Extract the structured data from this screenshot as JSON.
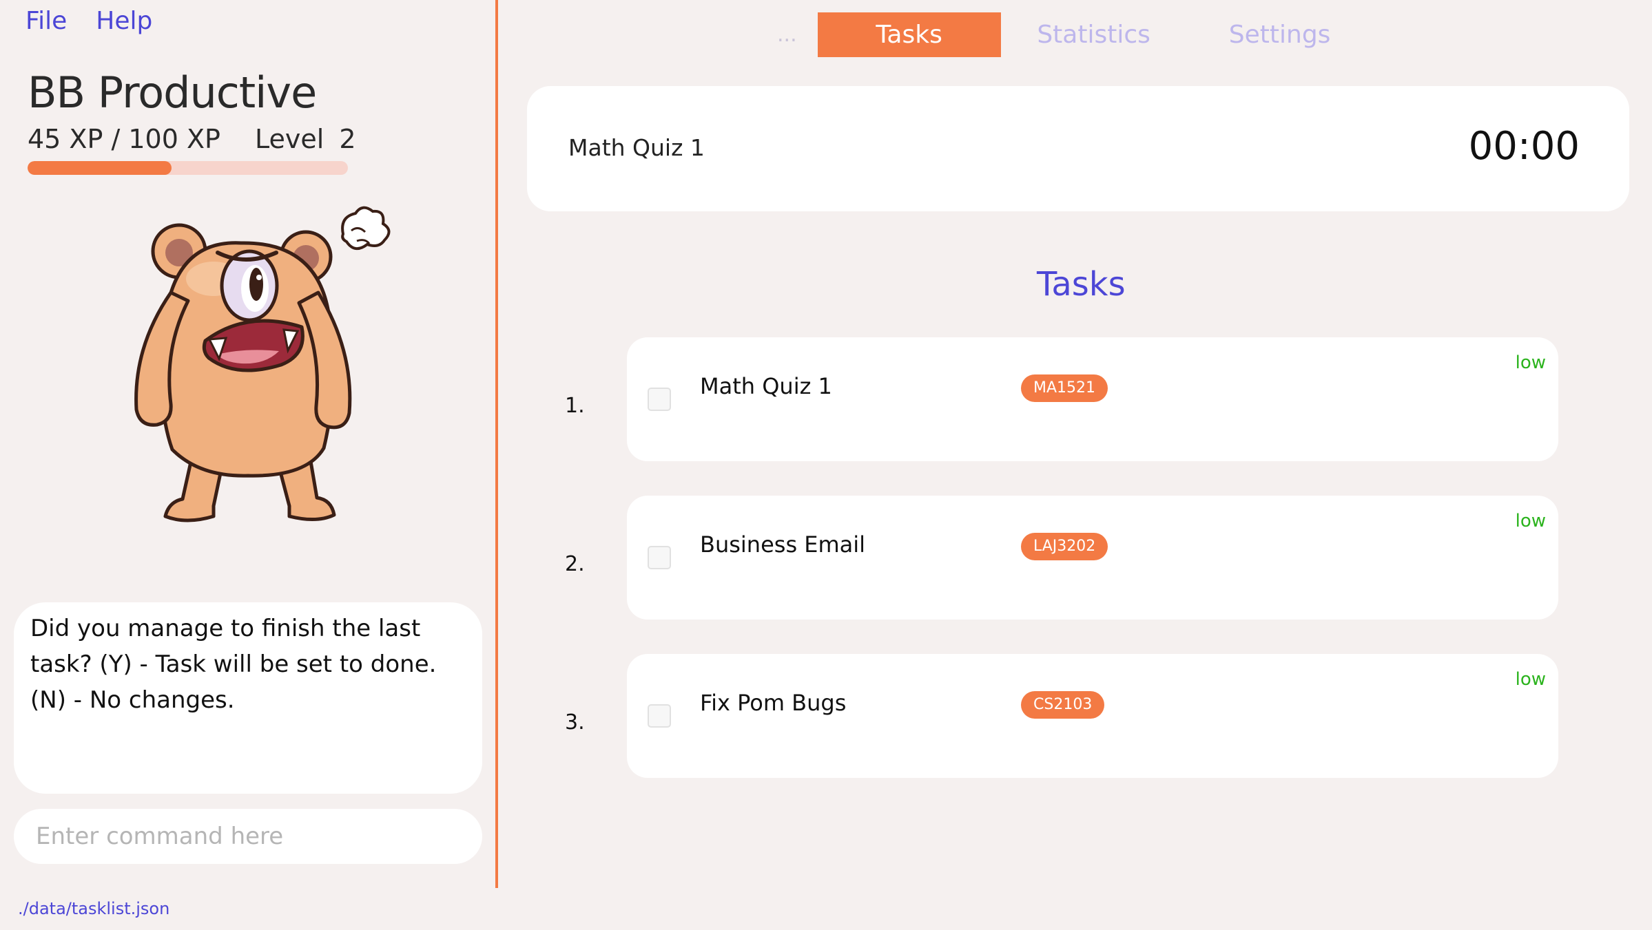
{
  "menu": {
    "file": "File",
    "help": "Help"
  },
  "app": {
    "title": "BB Productive"
  },
  "xp": {
    "text": "45 XP / 100 XP",
    "current": 45,
    "max": 100,
    "level_label": "Level",
    "level_value": "2"
  },
  "mascot": {
    "icon": "angry-bear-mascot-icon"
  },
  "bubble": {
    "message": "Did you manage to finish the last task? (Y) - Task will be set to done. (N) - No changes."
  },
  "command": {
    "placeholder": "Enter command here",
    "value": ""
  },
  "status": {
    "path": "./data/tasklist.json"
  },
  "tabs": {
    "dots": "...",
    "tasks": "Tasks",
    "statistics": "Statistics",
    "settings": "Settings"
  },
  "timer": {
    "task": "Math Quiz 1",
    "time": "00:00"
  },
  "tasks": {
    "heading": "Tasks",
    "items": [
      {
        "num": "1.",
        "name": "Math Quiz 1",
        "tag": "MA1521",
        "priority": "low"
      },
      {
        "num": "2.",
        "name": "Business Email",
        "tag": "LAJ3202",
        "priority": "low"
      },
      {
        "num": "3.",
        "name": "Fix Pom Bugs",
        "tag": "CS2103",
        "priority": "low"
      }
    ]
  },
  "colors": {
    "accent": "#f37a44",
    "link": "#4c46d6",
    "priority_low": "#2bb31d",
    "background": "#f5f0ef"
  }
}
